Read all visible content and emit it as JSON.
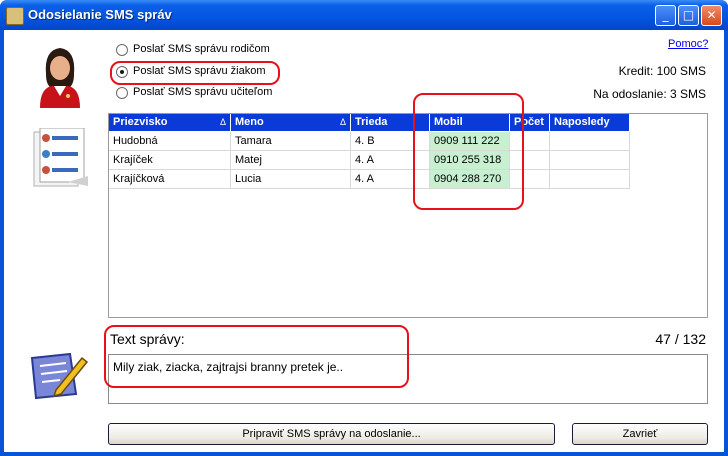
{
  "window": {
    "title": "Odosielanie SMS správ",
    "controls": {
      "minimize": "_",
      "maximize": "□",
      "close": "✕"
    }
  },
  "help_link": "Pomoc?",
  "recipients": {
    "options": [
      {
        "label": "Poslať SMS správu rodičom",
        "selected": false
      },
      {
        "label": "Poslať SMS správu žiakom",
        "selected": true
      },
      {
        "label": "Poslať SMS správu učiteľom",
        "selected": false
      }
    ]
  },
  "kredit": "Kredit: 100 SMS",
  "na_odoslanie": "Na odoslanie: 3 SMS",
  "table": {
    "columns": [
      "Priezvisko",
      "Meno",
      "Trieda",
      "Mobil",
      "Počet",
      "Naposledy"
    ],
    "sort_marker": "Δ",
    "rows": [
      [
        "Hudobná",
        "Tamara",
        "4. B",
        "0909 111 222",
        "",
        ""
      ],
      [
        "Krajíček",
        "Matej",
        "4. A",
        "0910 255 318",
        "",
        ""
      ],
      [
        "Krajíčková",
        "Lucia",
        "4. A",
        "0904 288 270",
        "",
        ""
      ]
    ]
  },
  "message": {
    "label": "Text správy:",
    "counter": "47 / 132",
    "text": "Mily ziak, ziacka, zajtrajsi branny pretek je.."
  },
  "buttons": {
    "prepare": "Pripraviť SMS správy na odoslanie...",
    "close": "Zavrieť"
  },
  "icons": {
    "avatar": "user-avatar-icon",
    "list": "contacts-list-icon",
    "edit": "edit-message-icon"
  },
  "colors": {
    "titlebar": "#0455e0",
    "grid_header": "#0a3ad8",
    "mobile_cell": "#c8f0d0",
    "annotation": "#e8101a"
  }
}
